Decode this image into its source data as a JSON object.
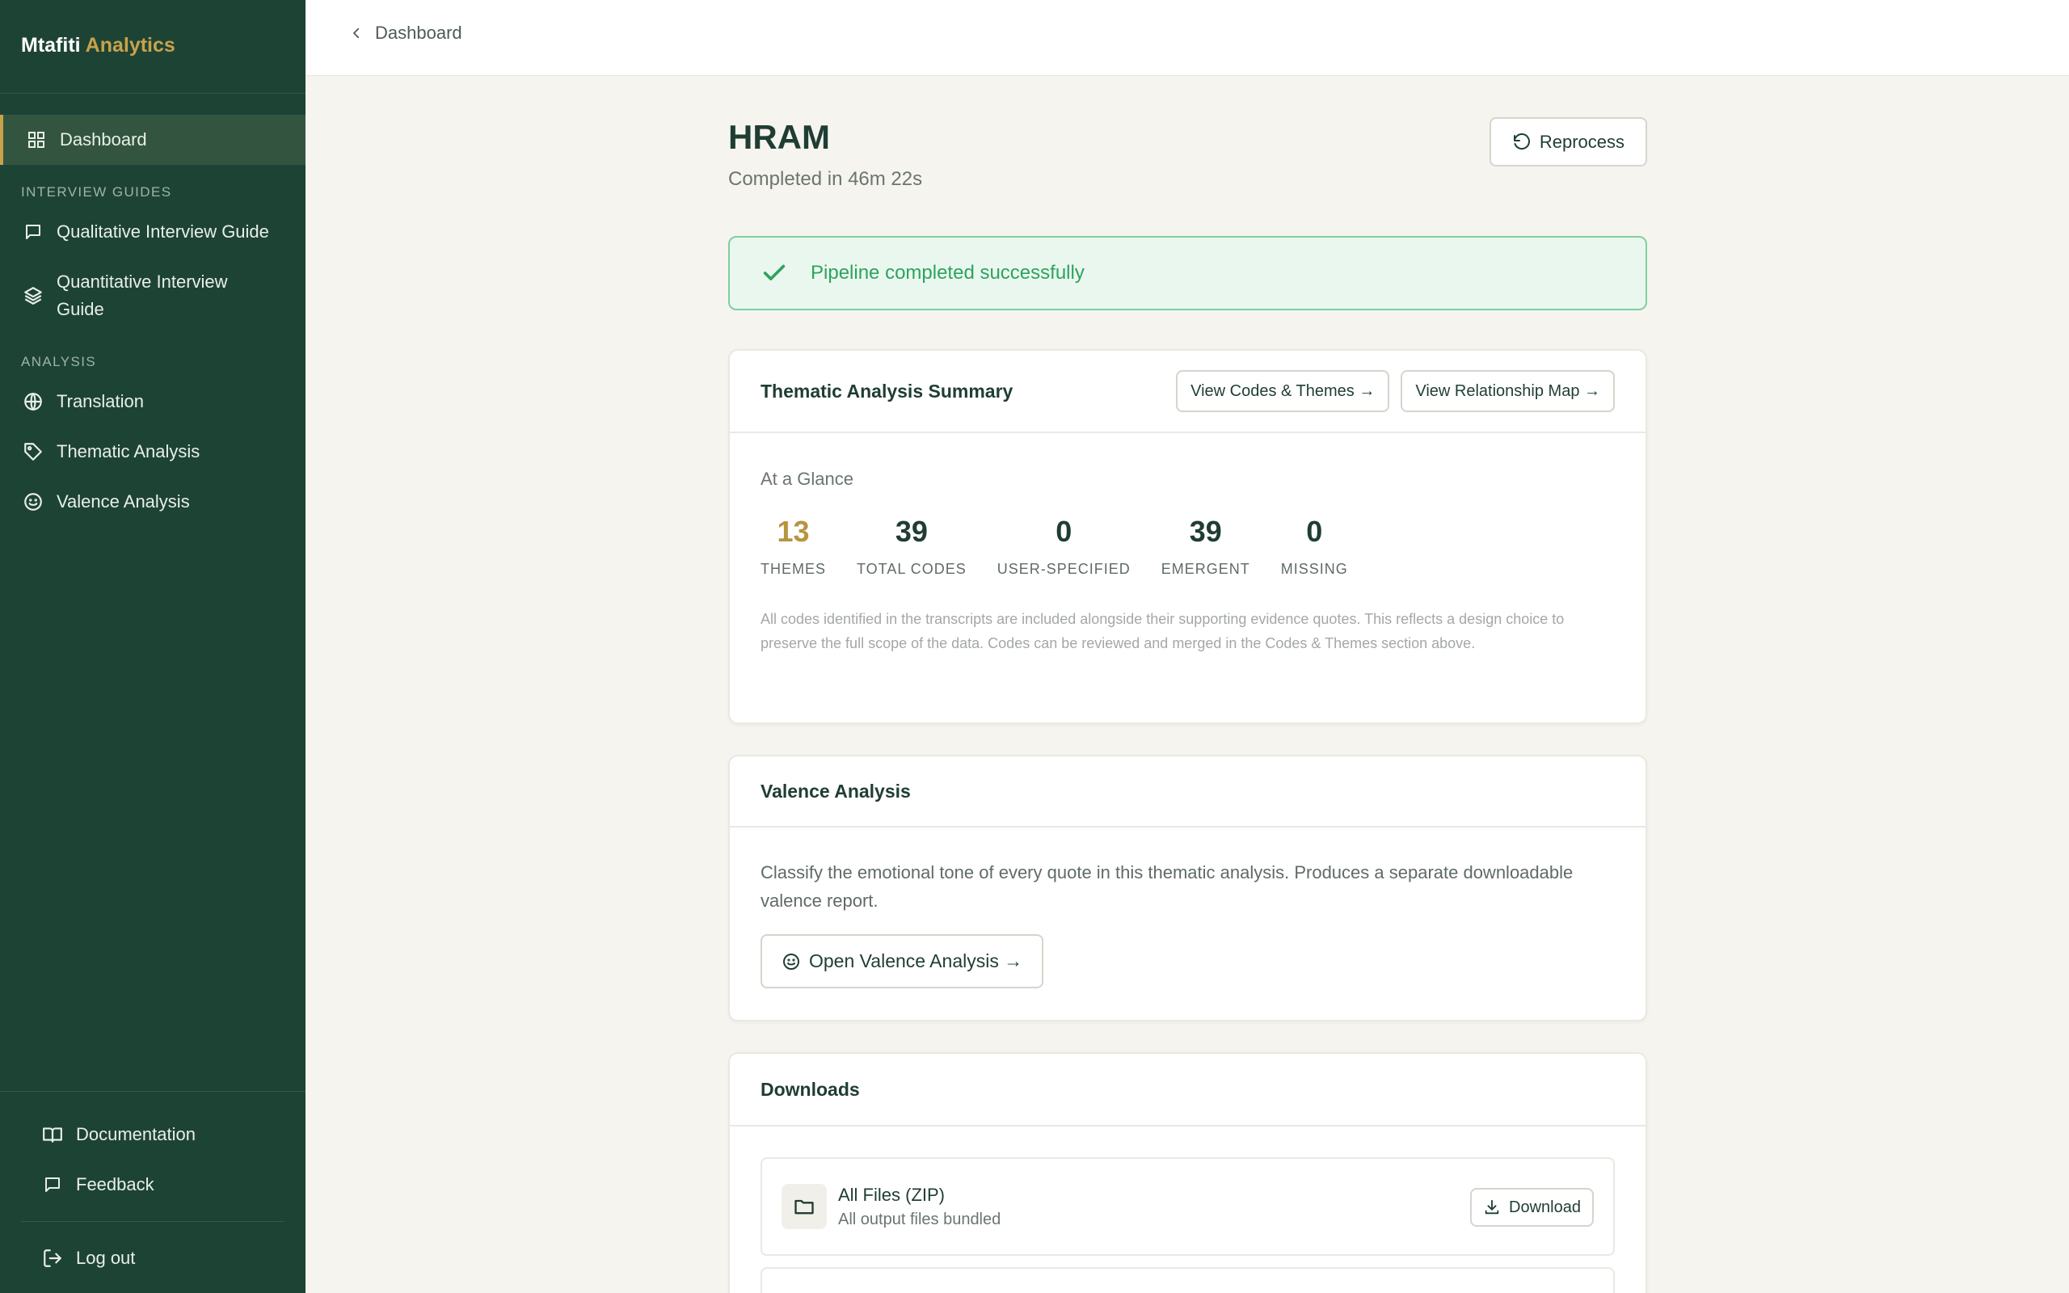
{
  "app": {
    "brand_part1": "Mtafiti",
    "brand_part2": "Analytics"
  },
  "colors": {
    "sidebar": "#1d4335",
    "accent_gold": "#c9a24b",
    "success": "#2da35e",
    "page_bg": "#f6f4ef"
  },
  "sidebar": {
    "dashboard": "Dashboard",
    "section_guides": "INTERVIEW GUIDES",
    "qualitative": "Qualitative Interview Guide",
    "quantitative": "Quantitative Interview Guide",
    "section_analysis": "ANALYSIS",
    "translation": "Translation",
    "thematic": "Thematic Analysis",
    "valence": "Valence Analysis",
    "documentation": "Documentation",
    "feedback": "Feedback",
    "logout": "Log out"
  },
  "topbar": {
    "back_label": "Dashboard"
  },
  "page": {
    "title": "HRAM",
    "subtitle": "Completed in 46m 22s",
    "reprocess_label": "Reprocess"
  },
  "alert": {
    "text": "Pipeline completed successfully"
  },
  "thematic": {
    "title": "Thematic Analysis Summary",
    "codes_button": "View Codes & Themes →",
    "map_button": "View Relationship Map →",
    "glance": "At a Glance",
    "stats": [
      {
        "value": "13",
        "label": "THEMES"
      },
      {
        "value": "39",
        "label": "TOTAL CODES"
      },
      {
        "value": "0",
        "label": "USER-SPECIFIED"
      },
      {
        "value": "39",
        "label": "EMERGENT"
      },
      {
        "value": "0",
        "label": "MISSING"
      }
    ],
    "note": "All codes identified in the transcripts are included alongside their supporting evidence quotes. This reflects a design choice to preserve the full scope of the data. Codes can be reviewed and merged in the Codes & Themes section above."
  },
  "valence": {
    "title": "Valence Analysis",
    "text": "Classify the emotional tone of every quote in this thematic analysis. Produces a separate downloadable valence report.",
    "button": "Open Valence Analysis →"
  },
  "downloads": {
    "title": "Downloads",
    "files": [
      {
        "name": "All Files (ZIP)",
        "desc": "All output files bundled",
        "button": "Download"
      }
    ]
  }
}
